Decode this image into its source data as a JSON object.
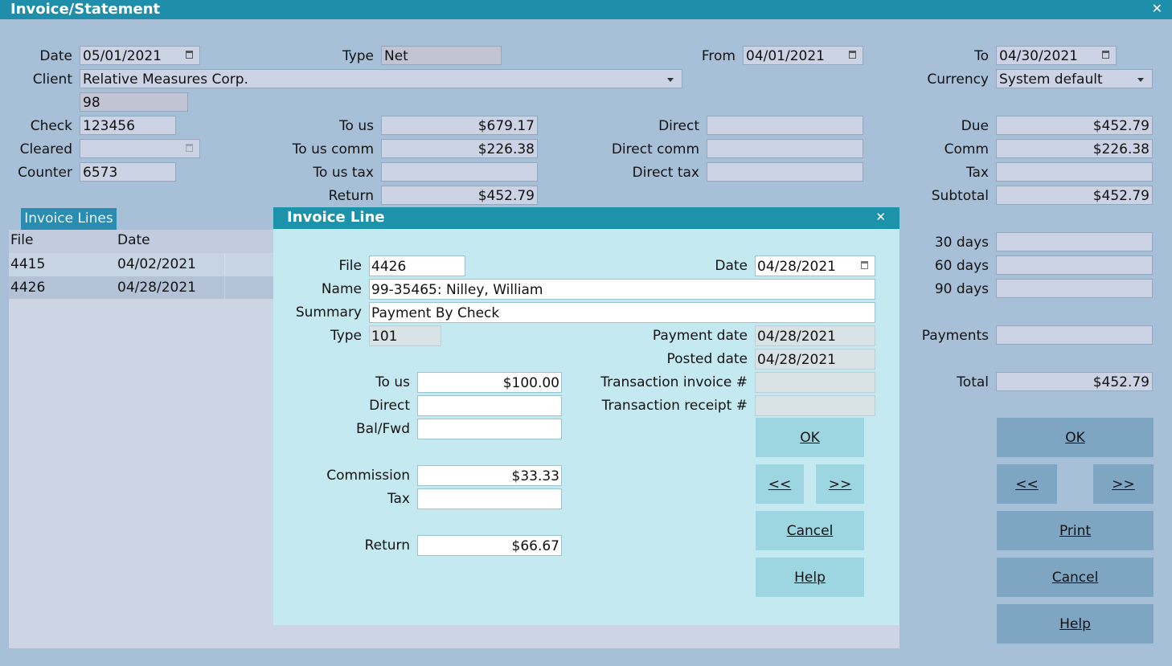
{
  "window": {
    "title": "Invoice/Statement",
    "close": "✕"
  },
  "header": {
    "date_label": "Date",
    "date_value": "05/01/2021",
    "type_label": "Type",
    "type_value": "Net",
    "from_label": "From",
    "from_value": "04/01/2021",
    "to_label": "To",
    "to_value": "04/30/2021",
    "client_label": "Client",
    "client_value": "Relative Measures Corp.",
    "client_id": "98",
    "currency_label": "Currency",
    "currency_value": "System default",
    "check_label": "Check",
    "check_value": "123456",
    "cleared_label": "Cleared",
    "cleared_value": "",
    "counter_label": "Counter",
    "counter_value": "6573"
  },
  "amounts": {
    "to_us_label": "To us",
    "to_us": "$679.17",
    "to_us_comm_label": "To us comm",
    "to_us_comm": "$226.38",
    "to_us_tax_label": "To us tax",
    "to_us_tax": "",
    "return_label": "Return",
    "return": "$452.79",
    "direct_label": "Direct",
    "direct": "",
    "direct_comm_label": "Direct comm",
    "direct_comm": "",
    "direct_tax_label": "Direct tax",
    "direct_tax": ""
  },
  "summary": {
    "due_label": "Due",
    "due": "$452.79",
    "comm_label": "Comm",
    "comm": "$226.38",
    "tax_label": "Tax",
    "tax": "",
    "subtotal_label": "Subtotal",
    "subtotal": "$452.79",
    "d30_label": "30 days",
    "d30": "",
    "d60_label": "60 days",
    "d60": "",
    "d90_label": "90 days",
    "d90": "",
    "payments_label": "Payments",
    "payments": "",
    "total_label": "Total",
    "total": "$452.79"
  },
  "invoice_lines": {
    "tab": "Invoice Lines",
    "columns": [
      "File",
      "Date"
    ],
    "rows": [
      {
        "file": "4415",
        "date": "04/02/2021"
      },
      {
        "file": "4426",
        "date": "04/28/2021"
      }
    ]
  },
  "main_buttons": {
    "ok": "OK",
    "prev": "<<",
    "next": ">>",
    "print": "Print",
    "cancel": "Cancel",
    "help": "Help"
  },
  "dialog": {
    "title": "Invoice Line",
    "close": "✕",
    "file_label": "File",
    "file": "4426",
    "date_label": "Date",
    "date": "04/28/2021",
    "name_label": "Name",
    "name": "99-35465: Nilley, William",
    "summary_label": "Summary",
    "summary": "Payment By Check",
    "type_label": "Type",
    "type": "101",
    "payment_date_label": "Payment date",
    "payment_date": "04/28/2021",
    "posted_date_label": "Posted date",
    "posted_date": "04/28/2021",
    "to_us_label": "To us",
    "to_us": "$100.00",
    "direct_label": "Direct",
    "direct": "",
    "balfwd_label": "Bal/Fwd",
    "balfwd": "",
    "txn_invoice_label": "Transaction invoice #",
    "txn_invoice": "",
    "txn_receipt_label": "Transaction receipt #",
    "txn_receipt": "",
    "commission_label": "Commission",
    "commission": "$33.33",
    "tax_label": "Tax",
    "tax": "",
    "return_label": "Return",
    "return": "$66.67",
    "buttons": {
      "ok": "OK",
      "prev": "<<",
      "next": ">>",
      "cancel": "Cancel",
      "help": "Help"
    }
  },
  "colors": {
    "titlebar": "#1e8eaa",
    "background": "#a7c0d8",
    "dialog": "#c4e9f1"
  }
}
